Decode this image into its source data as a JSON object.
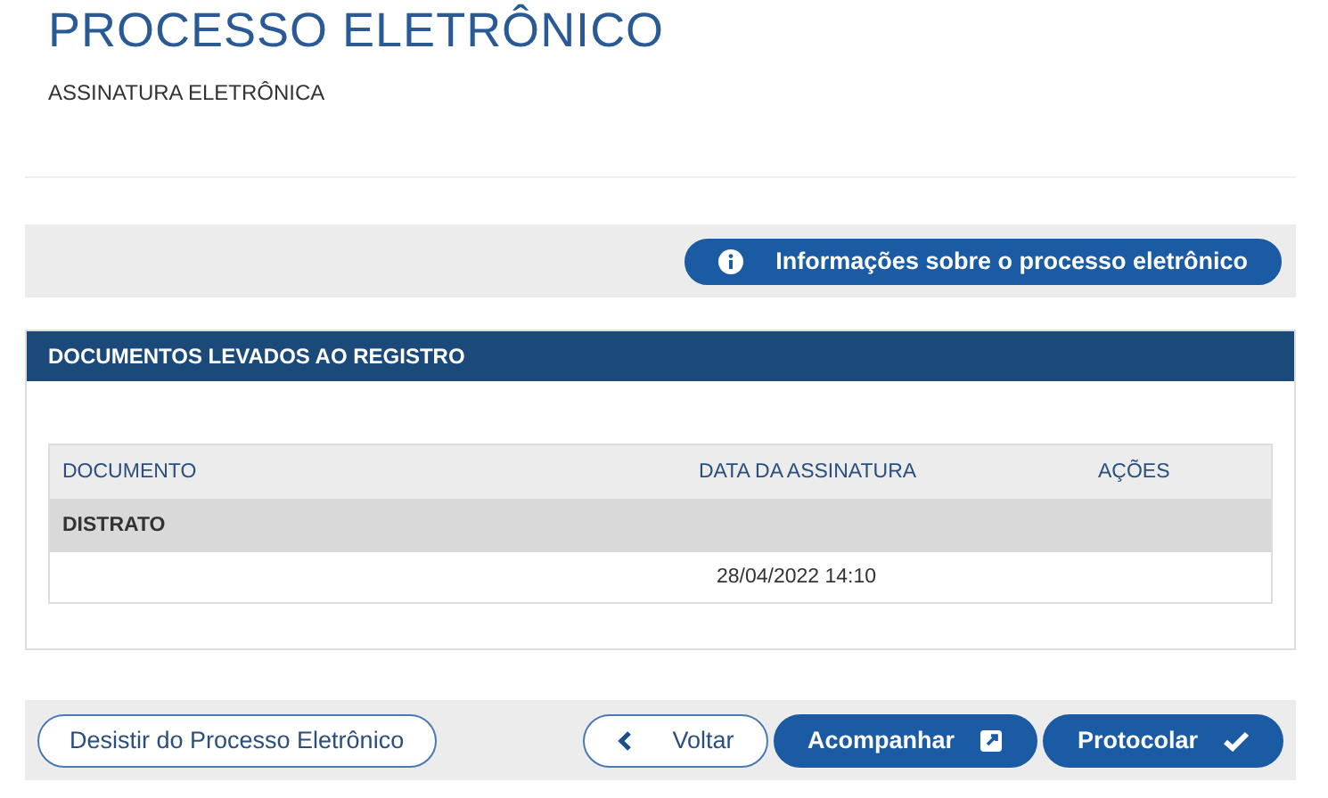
{
  "header": {
    "title": "PROCESSO ELETRÔNICO",
    "subtitle": "ASSINATURA ELETRÔNICA"
  },
  "info_button": {
    "label": "Informações sobre o processo eletrônico"
  },
  "panel": {
    "title": "DOCUMENTOS LEVADOS AO REGISTRO"
  },
  "table": {
    "columns": [
      "DOCUMENTO",
      "DATA DA ASSINATURA",
      "AÇÕES"
    ],
    "rows": [
      {
        "kind": "group",
        "cells": [
          "DISTRATO",
          "",
          ""
        ]
      },
      {
        "kind": "data",
        "cells": [
          "",
          "28/04/2022 14:10",
          ""
        ]
      }
    ]
  },
  "actions": [
    {
      "label": "Desistir do Processo Eletrônico",
      "kind": "outline"
    },
    {
      "label": "Voltar",
      "kind": "back"
    },
    {
      "label": "Acompanhar",
      "kind": "external"
    },
    {
      "label": "Protocolar",
      "kind": "confirm"
    }
  ]
}
